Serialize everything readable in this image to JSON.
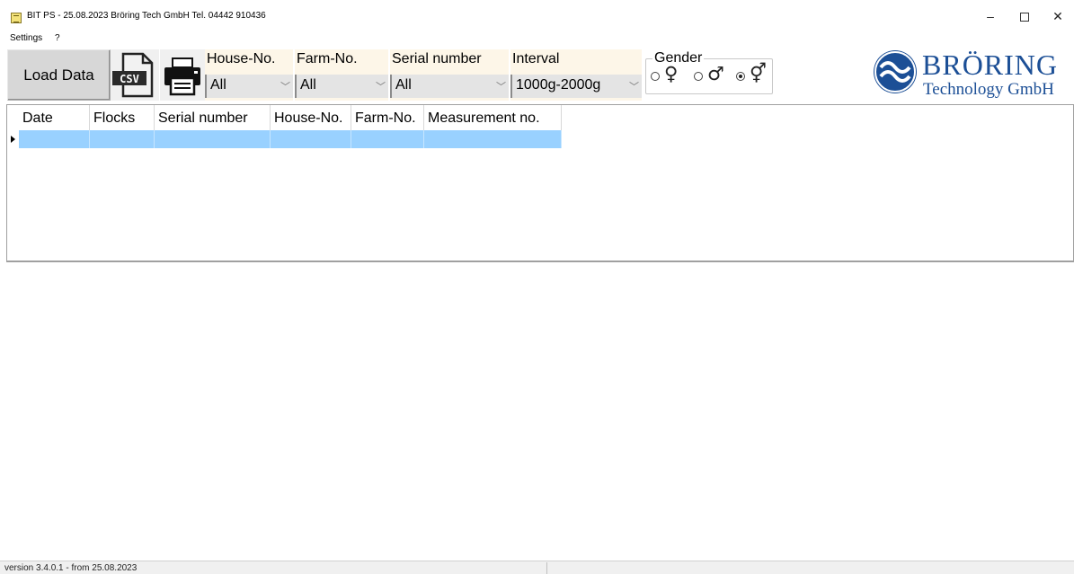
{
  "window": {
    "title": "BIT PS - 25.08.2023 Bröring Tech GmbH  Tel. 04442 910436",
    "controls": {
      "minimize": "–",
      "maximize": "",
      "close": "✕"
    }
  },
  "menu": {
    "settings": "Settings",
    "help": "?"
  },
  "toolbar": {
    "load_label": "Load Data",
    "csv_icon": "csv-file-icon",
    "csv_text": "CSV",
    "print_icon": "printer-icon",
    "filters": {
      "house": {
        "label": "House-No.",
        "value": "All"
      },
      "farm": {
        "label": "Farm-No.",
        "value": "All"
      },
      "serial": {
        "label": "Serial number",
        "value": "All"
      },
      "interval": {
        "label": "Interval",
        "value": "1000g-2000g"
      }
    },
    "gender": {
      "label": "Gender",
      "options": [
        {
          "symbol": "♀",
          "checked": false
        },
        {
          "symbol": "♂",
          "checked": false
        },
        {
          "symbol": "⚥",
          "checked": true
        }
      ]
    }
  },
  "logo": {
    "name": "BRÖRING",
    "subtitle": "Technology GmbH"
  },
  "grid": {
    "columns": [
      "Date",
      "Flocks",
      "Serial number",
      "House-No.",
      "Farm-No.",
      "Measurement no."
    ],
    "rows": [
      [
        "",
        "",
        "",
        "",
        "",
        ""
      ]
    ]
  },
  "status": {
    "version": "version 3.4.0.1 - from 25.08.2023"
  },
  "colors": {
    "selection": "#99d1ff",
    "brand": "#1c4f96",
    "filter_bg": "#fdf6e8"
  }
}
